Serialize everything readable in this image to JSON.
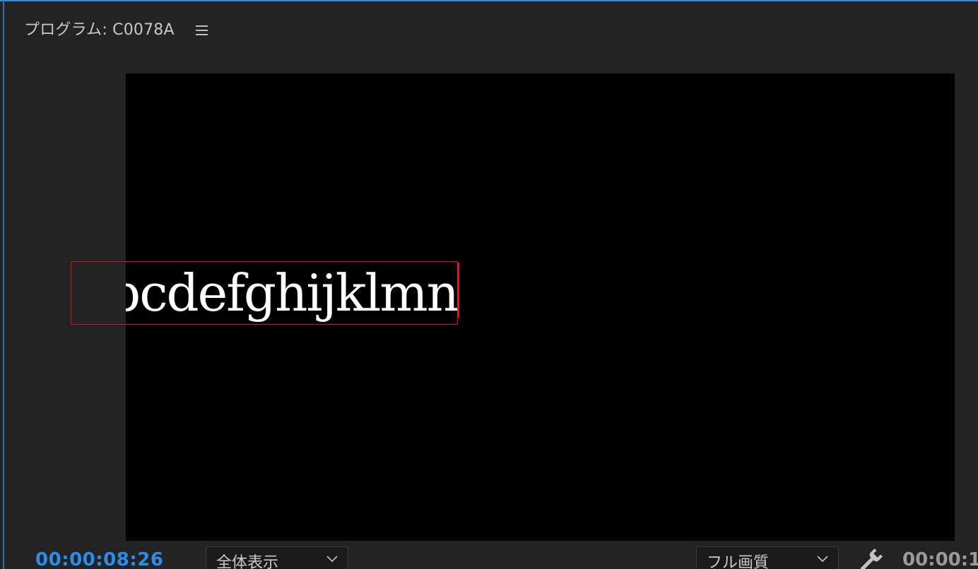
{
  "panel": {
    "title": "プログラム: C0078A",
    "menu_icon": "hamburger-menu-icon"
  },
  "viewer": {
    "title_text": "bcdefghijklmn"
  },
  "footer": {
    "current_timecode": "00:00:08:26",
    "zoom_select": "全体表示",
    "quality_select": "フル画質",
    "settings_icon": "wrench-icon",
    "duration_timecode": "00:00:1"
  },
  "colors": {
    "accent": "#2d8ceb",
    "selection_box": "#d4151f",
    "panel_bg": "#232323",
    "viewer_bg": "#000000"
  }
}
